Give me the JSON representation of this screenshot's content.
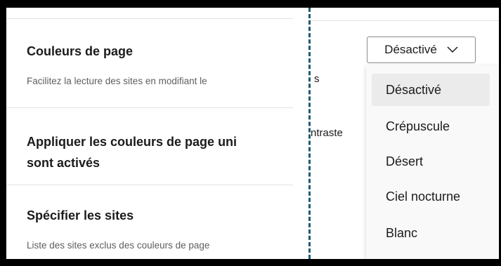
{
  "settings": [
    {
      "title": "Couleurs de page",
      "description": "Facilitez la lecture des sites en modifiant le"
    },
    {
      "title_line1": "Appliquer les couleurs de page uni",
      "title_line2": "sont activés"
    },
    {
      "title": "Spécifier les sites",
      "description": "Liste des sites exclus des couleurs de page"
    }
  ],
  "right_fragments": [
    "s",
    "ntraste"
  ],
  "dropdown": {
    "selected": "Désactivé",
    "options": [
      "Désactivé",
      "Crépuscule",
      "Désert",
      "Ciel nocturne",
      "Blanc"
    ]
  },
  "colors": {
    "divider": "#1d5b73",
    "selected_option_bg": "#ebebeb"
  },
  "icons": {
    "dropdown_arrow": "chevron-down-icon"
  }
}
